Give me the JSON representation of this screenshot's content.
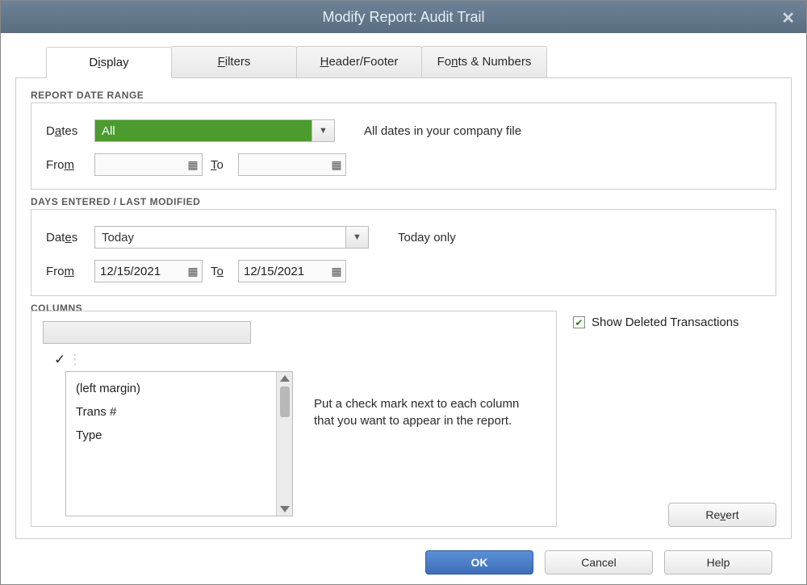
{
  "window": {
    "title": "Modify Report: Audit Trail"
  },
  "tabs": {
    "display_pre": "D",
    "display_ul": "i",
    "display_post": "splay",
    "filters_pre": "",
    "filters_ul": "F",
    "filters_post": "ilters",
    "header_pre": "",
    "header_ul": "H",
    "header_post": "eader/Footer",
    "fonts_pre": "Fo",
    "fonts_ul": "n",
    "fonts_post": "ts & Numbers"
  },
  "section1": {
    "title": "REPORT DATE RANGE",
    "dates_label_pre": "D",
    "dates_label_ul": "a",
    "dates_label_post": "tes",
    "dates_value": "All",
    "dates_desc": "All dates in your company file",
    "from_pre": "Fro",
    "from_ul": "m",
    "to_pre": "",
    "to_ul": "T",
    "to_post": "o",
    "from_value": "",
    "to_value": ""
  },
  "section2": {
    "title": "DAYS ENTERED / LAST MODIFIED",
    "dates_label_pre": "Dat",
    "dates_label_ul": "e",
    "dates_label_post": "s",
    "dates_value": "Today",
    "dates_desc": "Today only",
    "from_pre": "Fro",
    "from_ul": "m",
    "to_pre": "T",
    "to_ul": "o",
    "from_value": "12/15/2021",
    "to_value": "12/15/2021"
  },
  "columns": {
    "title": "COLUMNS",
    "check_mark": "✓",
    "items": [
      "(left margin)",
      "Trans #",
      "Type"
    ],
    "hint": "Put a check mark next to each column that you want to appear in the report.",
    "show_deleted_pre": "Show De",
    "show_deleted_ul": "l",
    "show_deleted_post": "eted Transactions",
    "show_deleted_checked": "✔",
    "revert_pre": "Re",
    "revert_ul": "v",
    "revert_post": "ert"
  },
  "footer": {
    "ok": "OK",
    "cancel": "Cancel",
    "help": "Help"
  }
}
